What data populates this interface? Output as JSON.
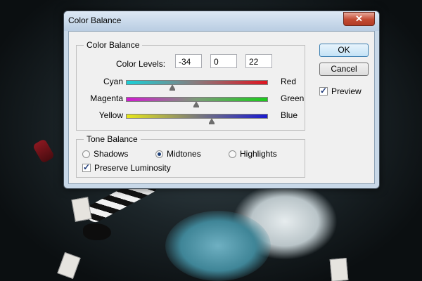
{
  "window": {
    "title": "Color Balance",
    "close_glyph": "✕"
  },
  "color_balance": {
    "legend": "Color Balance",
    "levels_label": "Color Levels:",
    "levels": [
      "-34",
      "0",
      "22"
    ],
    "sliders": [
      {
        "left": "Cyan",
        "right": "Red",
        "value": -34
      },
      {
        "left": "Magenta",
        "right": "Green",
        "value": 0
      },
      {
        "left": "Yellow",
        "right": "Blue",
        "value": 22
      }
    ],
    "slider_range": [
      -100,
      100
    ]
  },
  "tone_balance": {
    "legend": "Tone Balance",
    "options": [
      "Shadows",
      "Midtones",
      "Highlights"
    ],
    "selected": "Midtones",
    "preserve_luminosity_label": "Preserve Luminosity",
    "preserve_luminosity": true
  },
  "buttons": {
    "ok": "OK",
    "cancel": "Cancel"
  },
  "preview": {
    "label": "Preview",
    "checked": true
  },
  "colors": {
    "close_button": "#c24a32",
    "title_bar": "#c8d8e8",
    "dialog_bg": "#f0f0f0"
  }
}
